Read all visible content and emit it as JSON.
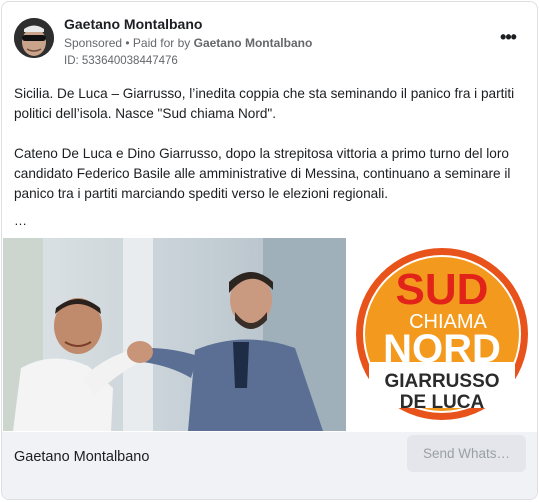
{
  "header": {
    "page_name": "Gaetano Montalbano",
    "sponsored": "Sponsored",
    "paid_for_prefix": " • Paid for by ",
    "paid_for_name": "Gaetano Montalbano",
    "ad_id": "ID: 533640038447476",
    "more_icon": "more-horizontal-icon",
    "more_glyph": "•••"
  },
  "post": {
    "paragraph1": "Sicilia. De Luca – Giarrusso, l’inedita coppia che sta seminando il panico fra i partiti politici dell’isola. Nasce \"Sud chiama Nord\".",
    "paragraph2": "Cateno De Luca e Dino Giarrusso, dopo la strepitosa vittoria a primo turno del loro candidato Federico Basile alle amministrative di Messina, continuano a seminare il panico tra i partiti marciando spediti verso le elezioni regionali.",
    "ellipsis": "…"
  },
  "logo": {
    "line1": "SUD",
    "line2": "CHIAMA",
    "line3": "NORD",
    "line4": "GIARRUSSO",
    "line5": "DE LUCA",
    "colors": {
      "ring": "#e8531c",
      "orange": "#f39a1e",
      "red": "#e2231a",
      "text_dark": "#2b2b2b"
    }
  },
  "footer": {
    "name": "Gaetano Montalbano",
    "cta_label": "Send Whats…"
  }
}
